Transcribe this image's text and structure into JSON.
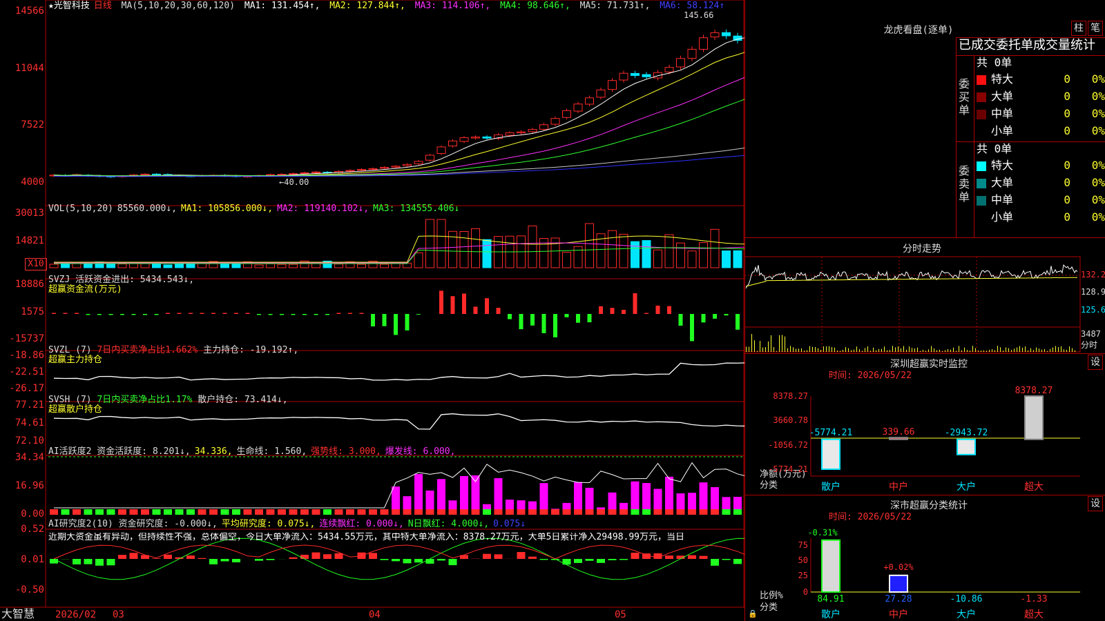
{
  "colors": {
    "up": "#ff2a2a",
    "down": "#00e5ff",
    "grid": "#b00000",
    "ma1": "#ffffff",
    "ma2": "#ffff30",
    "ma3": "#ff30ff",
    "ma4": "#30ff30",
    "ma5": "#c8c8c8",
    "ma6": "#3030ff"
  },
  "main": {
    "title": "★光智科技",
    "period": "日线",
    "ma_params": "MA(5,10,20,30,60,120)",
    "ma1": "MA1: 131.454↑,",
    "ma2": "MA2: 127.844↑,",
    "ma3": "MA3: 114.106↑,",
    "ma4": "MA4: 98.646↑,",
    "ma5": "MA5: 71.731↑,",
    "ma6": "MA6: 58.124↑",
    "y_ticks": [
      "14566",
      "11044",
      "7522",
      "4000"
    ],
    "high_label": "145.66",
    "low_label": "←40.00"
  },
  "vol": {
    "header": "VOL(5,10,20)",
    "v": "85560.000↓,",
    "ma1": "MA1: 105856.000↓,",
    "ma2": "MA2: 119140.102↓,",
    "ma3": "MA3: 134555.406↓",
    "y_ticks": [
      "30013",
      "14821"
    ],
    "unit": "X10"
  },
  "svzj": {
    "header": "SVZJ  活跃资金进出: 5434.543↓,",
    "sub": "超赢资金流(万元)",
    "y_ticks": [
      "18886",
      "1575",
      "-15737"
    ]
  },
  "svzl": {
    "header": "SVZL (7) ",
    "red": "7日内买卖净占比1.662%",
    "rest": " 主力持仓: -19.192↑,",
    "sub": "超赢主力持仓",
    "y_ticks": [
      "-18.86",
      "-22.51",
      "-26.17"
    ]
  },
  "svsh": {
    "header": "SVSH (7) ",
    "green": "7日内买卖净占比1.17%",
    "rest": " 散户持仓: 73.414↓,",
    "sub": "超赢散户持仓",
    "y_ticks": [
      "77.21",
      "74.61",
      "72.10"
    ]
  },
  "ai1": {
    "header": "AI活跃度2 资金活跃度: 8.201↓,",
    "v2": "34.336,",
    "v3": "生命线: 1.560,",
    "v4": "强势线: 3.000,",
    "v5": "爆发线: 6.000,",
    "y_ticks": [
      "34.34",
      "16.96",
      "0.00"
    ]
  },
  "ai2": {
    "header": "AI研究度2(10) 资金研究度: -0.000↓,",
    "v2": "平均研究度: 0.075↓,",
    "v3": "连续飘红: 0.000↓,",
    "v4": "N日飘红: 4.000↓,",
    "v5": "0.075↓",
    "commentary": "近期大资金虽有异动，但持续性不强，总体偏空，今日大单净流入：5434.55万元，其中特大单净流入：8378.27万元，大单5日累计净入29498.99万元，当日",
    "y_ticks": [
      "0.52",
      "0.01",
      "-0.50"
    ]
  },
  "bottom": {
    "brand": "大智慧",
    "date_labels": [
      "2026/02",
      "03",
      "04",
      "05"
    ]
  },
  "right": {
    "lhb": {
      "title": "龙虎看盘(逐单)",
      "btn1": "柱",
      "btn2": "笔",
      "subtitle": "已成交委托单成交量统计",
      "buy": {
        "side": "委买单",
        "total": "共 0单",
        "rows": [
          {
            "label": "特大",
            "v": "0",
            "p": "0%"
          },
          {
            "label": "大单",
            "v": "0",
            "p": "0%"
          },
          {
            "label": "中单",
            "v": "0",
            "p": "0%"
          },
          {
            "label": "小单",
            "v": "0",
            "p": "0%"
          }
        ]
      },
      "sell": {
        "side": "委卖单",
        "total": "共 0单",
        "rows": [
          {
            "label": "特大",
            "v": "0",
            "p": "0%"
          },
          {
            "label": "大单",
            "v": "0",
            "p": "0%"
          },
          {
            "label": "中单",
            "v": "0",
            "p": "0%"
          },
          {
            "label": "小单",
            "v": "0",
            "p": "0%"
          }
        ]
      }
    },
    "intraday": {
      "title": "分时走势",
      "y_labels": [
        "132.2",
        "128.9",
        "125.6"
      ],
      "vol_label": "3487",
      "vol_unit": "分时"
    },
    "monitor": {
      "title": "深圳超赢实时监控",
      "btn": "设",
      "time": "时间: 2026/05/22",
      "y_ticks": [
        "8378.27",
        "3660.78",
        "-1056.72",
        "-5774.21"
      ],
      "unit": "净额(万元)",
      "cat_label": "分类",
      "cats": [
        "散户",
        "中户",
        "大户",
        "超大"
      ],
      "values": [
        -5774.21,
        339.66,
        -2943.72,
        8378.27
      ],
      "value_labels": [
        "-5774.21",
        "339.66",
        "-2943.72",
        "8378.27"
      ]
    },
    "cls": {
      "title": "深市超赢分类统计",
      "btn": "设",
      "time": "时间: 2026/05/22",
      "y_ticks": [
        "75",
        "50",
        "25",
        "0"
      ],
      "unit": "比例%",
      "cat_label": "分类",
      "cats": [
        "散户",
        "中户",
        "大户",
        "超大"
      ],
      "values": [
        84.91,
        27.28,
        -10.86,
        -1.33
      ],
      "top_labels": [
        "-0.31%",
        "+0.02%"
      ]
    }
  },
  "chart_data": [
    {
      "type": "candlestick",
      "title": "★光智科技 日线",
      "ylim": [
        4000,
        14566
      ],
      "close": [
        43.5,
        43.2,
        43.8,
        43.0,
        42.7,
        42.4,
        42.9,
        43.6,
        44.1,
        43.8,
        43.3,
        43.1,
        42.9,
        43.2,
        43.4,
        43.0,
        42.6,
        42.8,
        43.3,
        43.8,
        44.0,
        44.4,
        44.9,
        45.4,
        45.0,
        45.8,
        46.4,
        47.0,
        47.5,
        48.3,
        49.0,
        50.1,
        52.0,
        55.8,
        60.9,
        64.6,
        66.6,
        67.0,
        66.3,
        68.4,
        69.6,
        70.2,
        71.7,
        74.6,
        78.5,
        83.3,
        87.4,
        91.2,
        96.1,
        101.9,
        106.4,
        105.0,
        104.2,
        106.8,
        110.0,
        115.5,
        121.2,
        128.3,
        131.4,
        129.5,
        126.7,
        128.6,
        131.5,
        133.4,
        136.6,
        138.6,
        138.6,
        135.9
      ],
      "open": [
        43.0,
        43.4,
        43.4,
        43.5,
        43.1,
        42.8,
        42.5,
        43.0,
        43.6,
        44.1,
        43.9,
        43.3,
        43.0,
        43.0,
        43.3,
        43.4,
        43.1,
        42.5,
        42.9,
        43.4,
        43.7,
        44.1,
        44.6,
        45.0,
        45.3,
        45.1,
        45.9,
        46.5,
        47.0,
        47.7,
        48.4,
        49.3,
        50.5,
        52.7,
        56.8,
        61.5,
        64.3,
        66.4,
        67.1,
        66.2,
        68.1,
        69.6,
        70.3,
        71.8,
        74.9,
        79.1,
        83.0,
        87.3,
        91.6,
        96.4,
        102.2,
        106.3,
        105.6,
        103.5,
        107.2,
        110.3,
        115.6,
        121.2,
        128.8,
        131.5,
        129.4,
        126.9,
        128.2,
        131.6,
        133.0,
        136.3,
        139.2,
        138.9
      ]
    },
    {
      "type": "bar",
      "name": "VOL",
      "ylim": [
        0,
        30013
      ]
    },
    {
      "type": "bar",
      "name": "SVZJ",
      "ylim": [
        -15737,
        18886
      ]
    },
    {
      "type": "line",
      "name": "SVZL",
      "ylim": [
        -26.17,
        -18.86
      ]
    },
    {
      "type": "line",
      "name": "SVSH",
      "ylim": [
        72.1,
        77.21
      ]
    },
    {
      "type": "bar",
      "name": "AI活跃度2",
      "ylim": [
        0,
        34.34
      ]
    },
    {
      "type": "bar",
      "name": "AI研究度2",
      "ylim": [
        -0.5,
        0.52
      ]
    },
    {
      "type": "bar",
      "title": "深圳超赢实时监控",
      "categories": [
        "散户",
        "中户",
        "大户",
        "超大"
      ],
      "values": [
        -5774.21,
        339.66,
        -2943.72,
        8378.27
      ]
    },
    {
      "type": "bar",
      "title": "深市超赢分类统计",
      "categories": [
        "散户",
        "中户",
        "大户",
        "超大"
      ],
      "values": [
        84.91,
        27.28,
        -10.86,
        -1.33
      ]
    }
  ]
}
